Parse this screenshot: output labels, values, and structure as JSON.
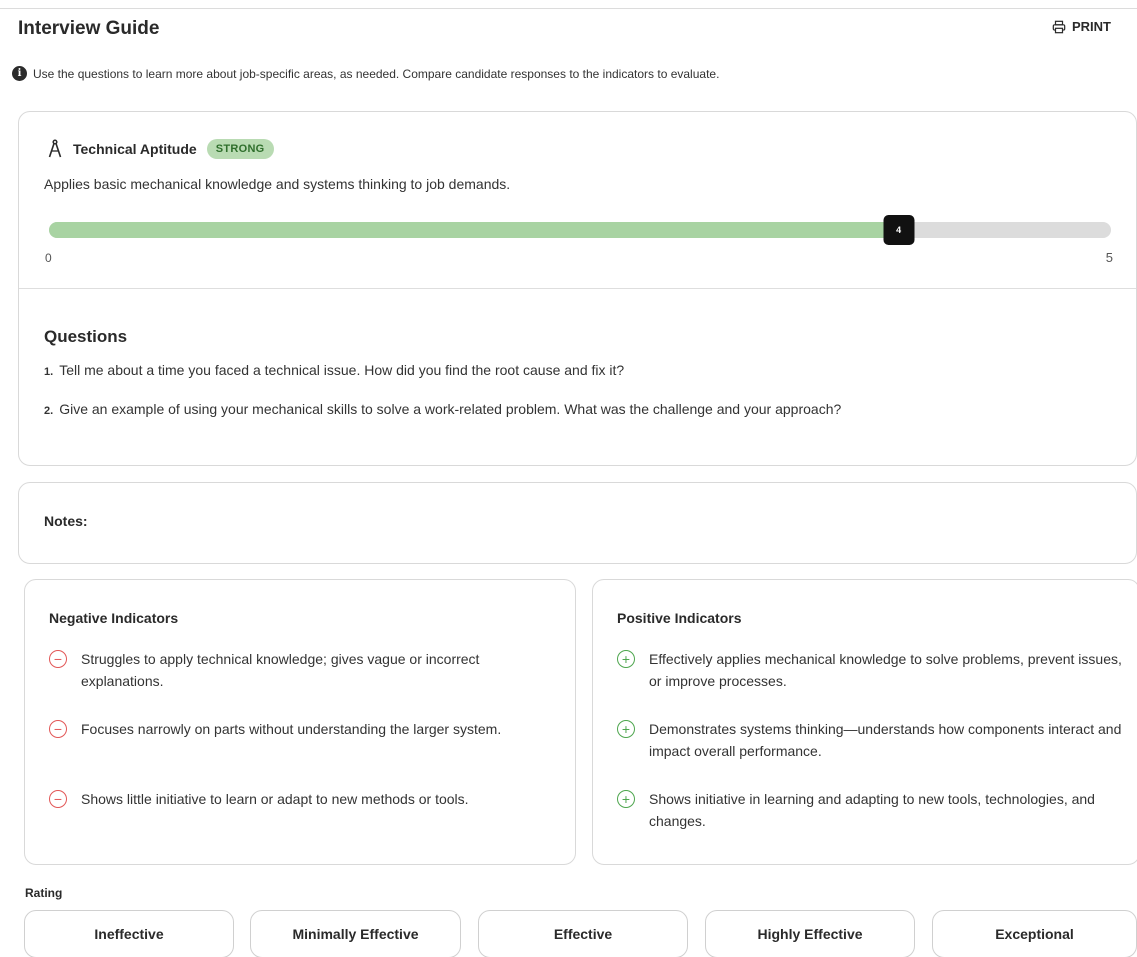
{
  "header": {
    "title": "Interview Guide",
    "print_label": "PRINT"
  },
  "info": {
    "icon": "info-icon",
    "text": "Use the questions to learn more about job-specific areas, as needed. Compare candidate responses to the indicators to evaluate."
  },
  "competency": {
    "icon": "compass-icon",
    "name": "Technical Aptitude",
    "badge": "STRONG",
    "description": "Applies basic mechanical knowledge and systems thinking to job demands.",
    "score": 4,
    "score_label": "4",
    "scale_min": "0",
    "scale_max": "5",
    "fill_color": "#a8d3a2",
    "track_color": "#dcdcdc"
  },
  "questions": {
    "heading": "Questions",
    "items": [
      {
        "num": "1.",
        "text": "Tell me about a time you faced a technical issue. How did you find the root cause and fix it?"
      },
      {
        "num": "2.",
        "text": "Give an example of using your mechanical skills to solve a work-related problem. What was the challenge and your approach?"
      }
    ]
  },
  "notes": {
    "label": "Notes:"
  },
  "negative": {
    "title": "Negative Indicators",
    "icon": "minus-circle-icon",
    "color": "#e25757",
    "items": [
      "Struggles to apply technical knowledge; gives vague or incorrect explanations.",
      "Focuses narrowly on parts without understanding the larger system.",
      "Shows little initiative to learn or adapt to new methods or tools."
    ]
  },
  "positive": {
    "title": "Positive Indicators",
    "icon": "plus-circle-icon",
    "color": "#4ea64e",
    "items": [
      "Effectively applies mechanical knowledge to solve problems, prevent issues, or improve processes.",
      "Demonstrates systems thinking—understands how components interact and impact overall performance.",
      "Shows initiative in learning and adapting to new tools, technologies, and changes."
    ]
  },
  "rating": {
    "label": "Rating",
    "options": [
      "Ineffective",
      "Minimally Effective",
      "Effective",
      "Highly Effective",
      "Exceptional"
    ]
  }
}
